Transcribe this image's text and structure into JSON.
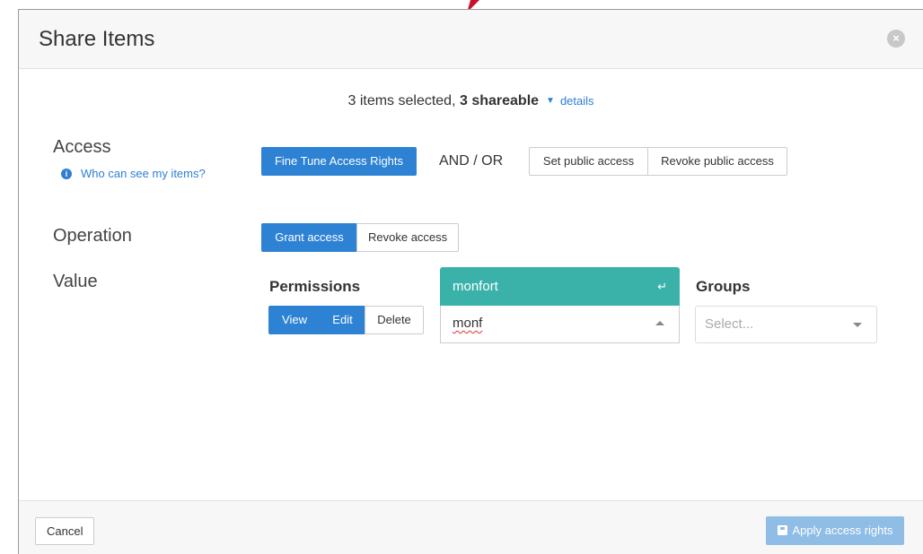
{
  "modal": {
    "title": "Share Items",
    "close_glyph": "×"
  },
  "summary": {
    "count_text": "3 items selected,",
    "shareable_text": "3 shareable",
    "caret_glyph": "▼",
    "details_link": "details"
  },
  "access": {
    "label": "Access",
    "help_link": "Who can see my items?",
    "info_glyph": "i",
    "fine_tune_button": "Fine Tune Access Rights",
    "and_or": "AND / OR",
    "set_public_button": "Set public access",
    "revoke_public_button": "Revoke public access"
  },
  "operation": {
    "label": "Operation",
    "grant_button": "Grant access",
    "revoke_button": "Revoke access",
    "selected": "Grant access"
  },
  "value": {
    "label": "Value",
    "permissions": {
      "heading": "Permissions",
      "view": "View",
      "edit": "Edit",
      "delete": "Delete",
      "selected": [
        "View",
        "Edit"
      ]
    },
    "user_select": {
      "highlighted_option": "monfort",
      "enter_glyph": "↵",
      "typed_value": "monf"
    },
    "groups": {
      "heading": "Groups",
      "placeholder": "Select..."
    }
  },
  "footer": {
    "cancel_button": "Cancel",
    "apply_button": "Apply access rights"
  },
  "colors": {
    "primary": "#2d82d4",
    "highlight": "#3ab2aa",
    "disabled_primary": "#8fbde6",
    "arrow_red": "#c8102e"
  }
}
